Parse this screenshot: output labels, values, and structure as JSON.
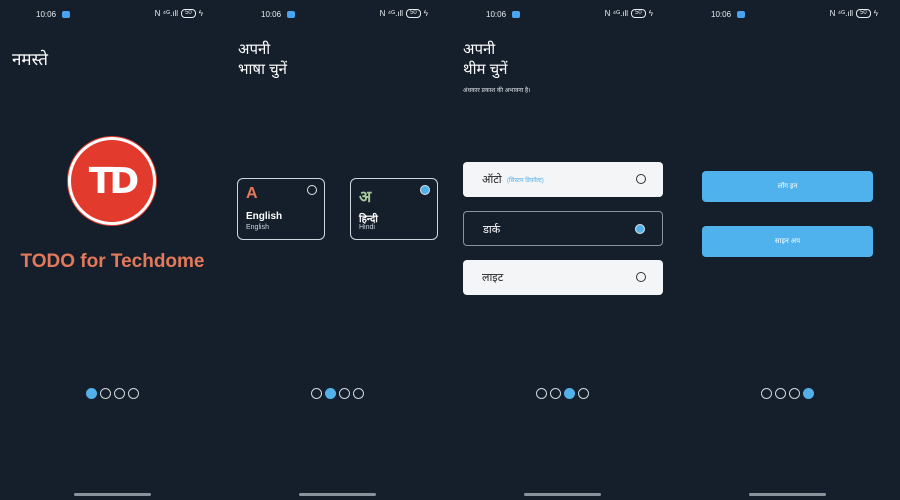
{
  "status_bar": {
    "time": "10:06",
    "right_text": "N ⁴ᴳ.ıll",
    "battery": "50"
  },
  "screens": [
    {
      "greeting": "नमस्ते",
      "logo_text": "TD",
      "app_name": "TODO for Techdome",
      "active_dot": 0
    },
    {
      "title_line1": "अपनी",
      "title_line2": "भाषा चुनें",
      "languages": [
        {
          "glyph": "A",
          "name": "English",
          "sub": "English",
          "selected": false,
          "color": "#e3795a"
        },
        {
          "glyph": "अ",
          "name": "हिन्दी",
          "sub": "Hindi",
          "selected": true,
          "color": "#a8c89a"
        }
      ],
      "active_dot": 1
    },
    {
      "title_line1": "अपनी",
      "title_line2": "थीम चुनें",
      "subtitle": "अंधकार प्रकाश की अभावना है।",
      "themes": [
        {
          "label": "ऑटो",
          "hint": "(सिस्टम डिफ़ॉल्ट)",
          "selected": false,
          "style": "light"
        },
        {
          "label": "डार्क",
          "hint": "",
          "selected": true,
          "style": "dark"
        },
        {
          "label": "लाइट",
          "hint": "",
          "selected": false,
          "style": "light"
        }
      ],
      "active_dot": 2
    },
    {
      "login_label": "लॉग इन",
      "signup_label": "साइन अप",
      "active_dot": 3
    }
  ],
  "colors": {
    "background": "#151f2b",
    "accent": "#53b1ea",
    "brand": "#e23b2e",
    "brand_text": "#e3795a"
  },
  "icons": {
    "notification": "message-notification-icon",
    "battery": "battery-icon",
    "charging": "bolt-icon"
  }
}
